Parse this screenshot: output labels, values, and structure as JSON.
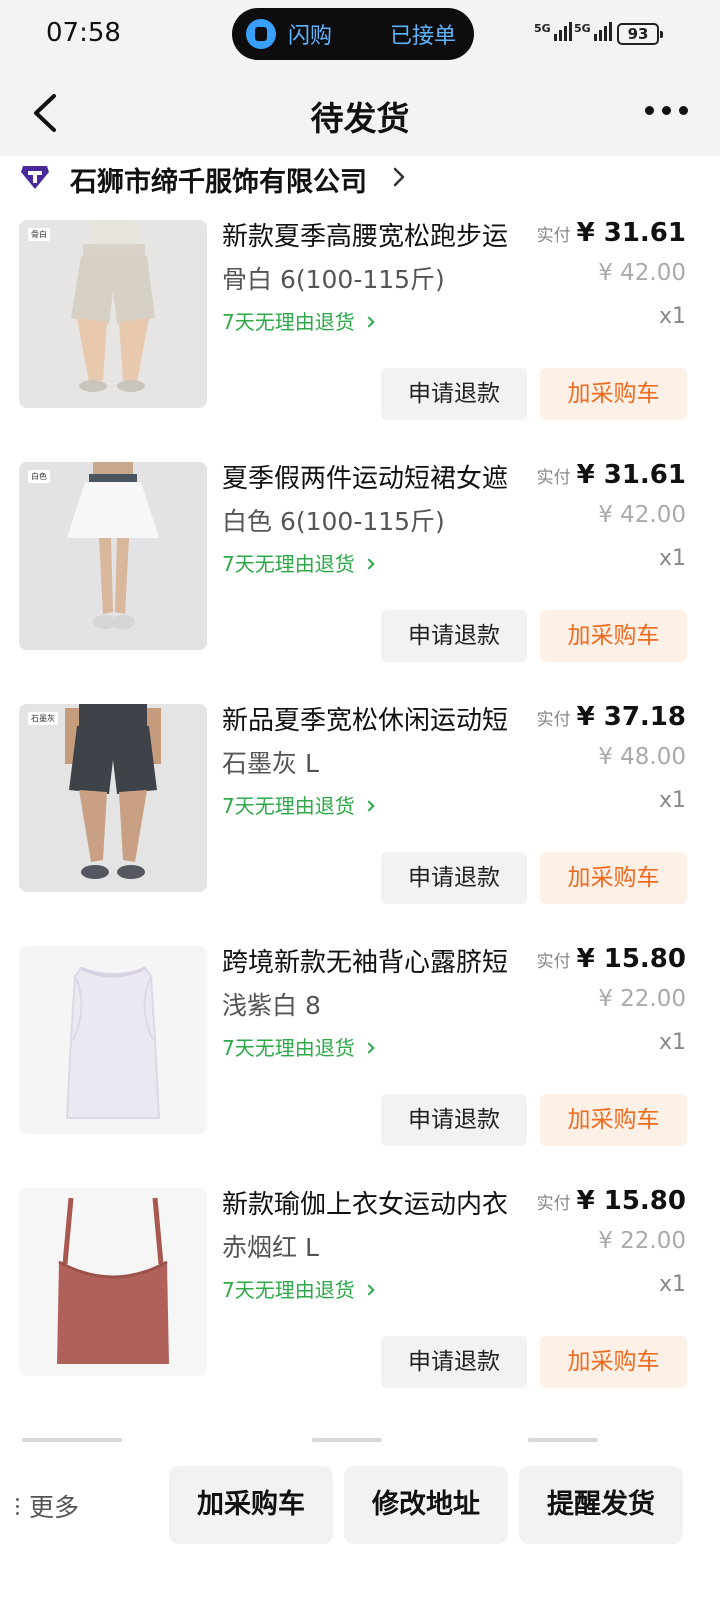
{
  "status_bar": {
    "time": "07:58",
    "live_app": "闪购",
    "live_status": "已接单",
    "signal_1": "5G",
    "signal_2": "5G",
    "battery": "93"
  },
  "nav": {
    "title": "待发货",
    "back_icon": "chevron-left-icon",
    "more_icon": "more-horizontal-icon"
  },
  "shop": {
    "name": "石狮市缔千服饰有限公司",
    "logo_icon": "shop-logo-icon"
  },
  "items": [
    {
      "title": "新款夏季高腰宽松跑步运",
      "spec": "骨白 6(100-115斤)",
      "return_policy": "7天无理由退货",
      "paid_label": "实付",
      "paid_price": "¥ 31.61",
      "original_price": "¥ 42.00",
      "qty": "x1",
      "refund_label": "申请退款",
      "cart_label": "加采购车",
      "thumb_tag": "骨白"
    },
    {
      "title": "夏季假两件运动短裙女遮",
      "spec": "白色 6(100-115斤)",
      "return_policy": "7天无理由退货",
      "paid_label": "实付",
      "paid_price": "¥ 31.61",
      "original_price": "¥ 42.00",
      "qty": "x1",
      "refund_label": "申请退款",
      "cart_label": "加采购车",
      "thumb_tag": "白色"
    },
    {
      "title": "新品夏季宽松休闲运动短",
      "spec": "石墨灰 L",
      "return_policy": "7天无理由退货",
      "paid_label": "实付",
      "paid_price": "¥ 37.18",
      "original_price": "¥ 48.00",
      "qty": "x1",
      "refund_label": "申请退款",
      "cart_label": "加采购车",
      "thumb_tag": "石墨灰"
    },
    {
      "title": "跨境新款无袖背心露脐短",
      "spec": "浅紫白 8",
      "return_policy": "7天无理由退货",
      "paid_label": "实付",
      "paid_price": "¥ 15.80",
      "original_price": "¥ 22.00",
      "qty": "x1",
      "refund_label": "申请退款",
      "cart_label": "加采购车",
      "thumb_tag": ""
    },
    {
      "title": "新款瑜伽上衣女运动内衣",
      "spec": "赤烟红 L",
      "return_policy": "7天无理由退货",
      "paid_label": "实付",
      "paid_price": "¥ 15.80",
      "original_price": "¥ 22.00",
      "qty": "x1",
      "refund_label": "申请退款",
      "cart_label": "加采购车",
      "thumb_tag": ""
    }
  ],
  "bottom_bar": {
    "more_label": "更多",
    "add_cart_label": "加采购车",
    "change_address_label": "修改地址",
    "remind_ship_label": "提醒发货"
  },
  "colors": {
    "accent_orange": "#f06a20",
    "return_green": "#2ea94a",
    "cart_bg": "#fdf1e7",
    "header_bg": "#f3f3f3"
  }
}
